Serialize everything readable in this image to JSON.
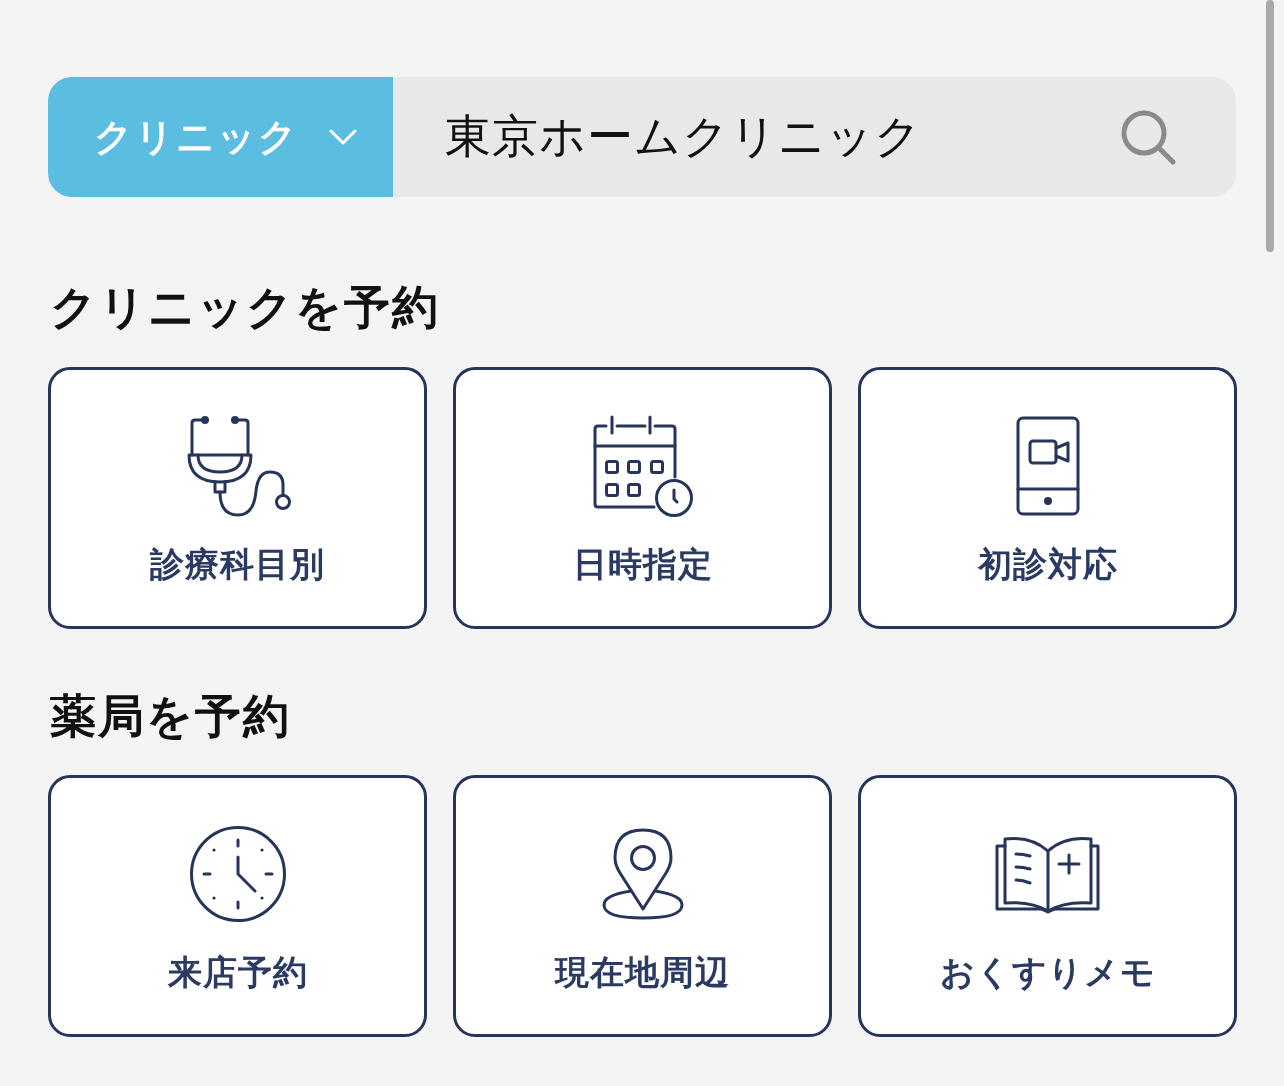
{
  "search": {
    "category": {
      "label": "クリニック"
    },
    "query": "東京ホームクリニック"
  },
  "sections": [
    {
      "title": "クリニックを予約",
      "items": [
        {
          "label": "診療科目別"
        },
        {
          "label": "日時指定"
        },
        {
          "label": "初診対応"
        }
      ]
    },
    {
      "title": "薬局を予約",
      "items": [
        {
          "label": "来店予約"
        },
        {
          "label": "現在地周辺"
        },
        {
          "label": "おくすりメモ"
        }
      ]
    }
  ]
}
